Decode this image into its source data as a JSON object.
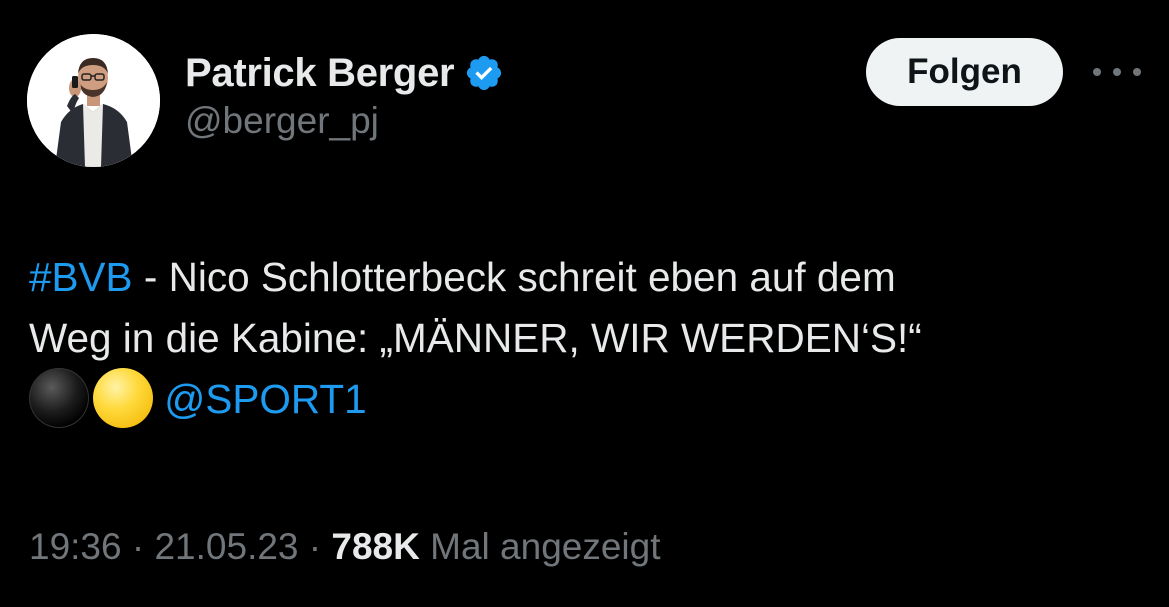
{
  "author": {
    "display_name": "Patrick Berger",
    "handle": "@berger_pj",
    "verified": true,
    "verified_color": "#1d9bf0"
  },
  "actions": {
    "follow_label": "Folgen",
    "more_icon": "ellipsis-horizontal-icon"
  },
  "tweet": {
    "hashtag": "#BVB",
    "line1_rest": " - Nico Schlotterbeck schreit eben auf dem",
    "line2": "Weg in die Kabine: „MÄNNER, WIR WERDEN‘S!“",
    "emojis": [
      "black-circle-emoji",
      "yellow-circle-emoji"
    ],
    "mention": "@SPORT1"
  },
  "meta": {
    "time": "19:36",
    "separator1": " · ",
    "date": "21.05.23",
    "separator2": " · ",
    "views_count": "788K",
    "views_label": " Mal angezeigt"
  },
  "colors": {
    "background": "#000000",
    "text_primary": "#e7e9ea",
    "text_secondary": "#71767b",
    "accent": "#1d9bf0",
    "follow_button_bg": "#eff3f4"
  }
}
